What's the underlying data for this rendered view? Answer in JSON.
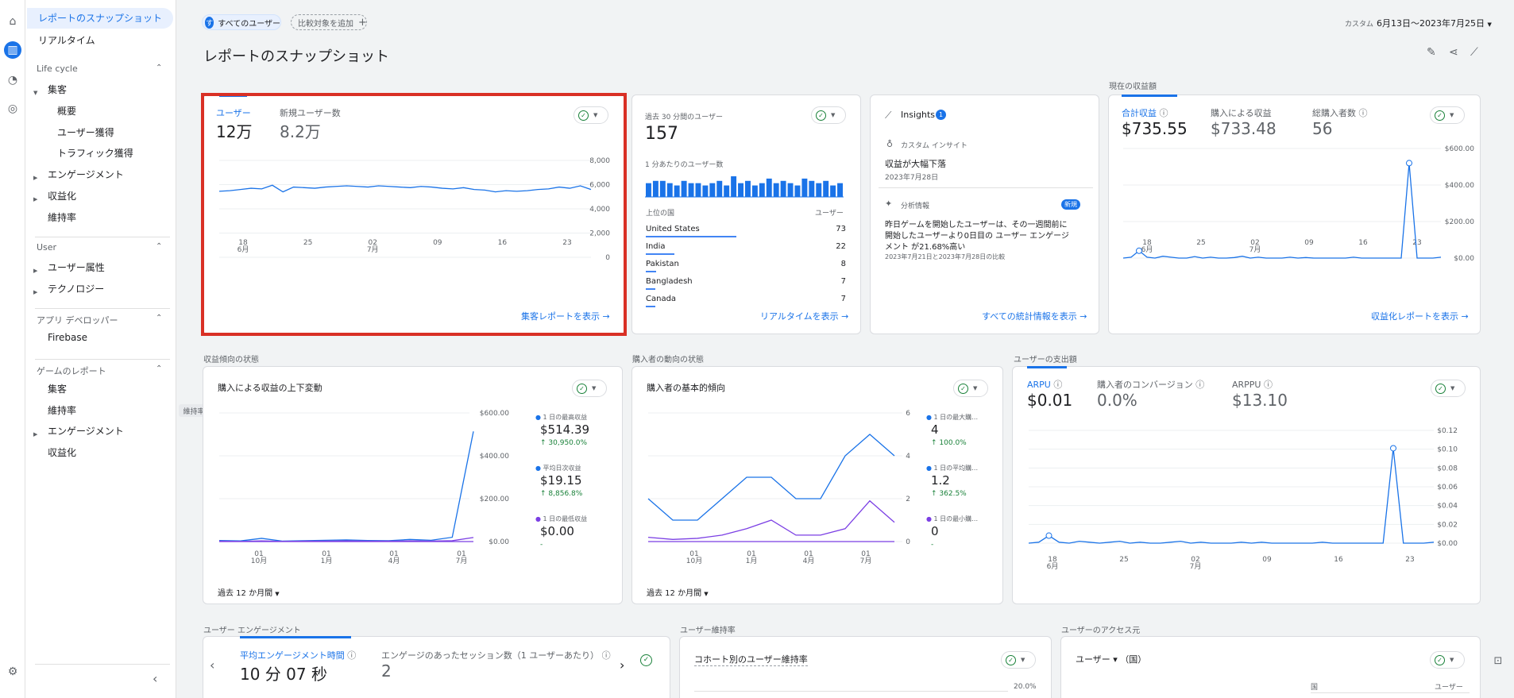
{
  "nav": {
    "items": [
      {
        "label": "レポートのスナップショット",
        "top": 22,
        "left": 48
      },
      {
        "label": "リアルタイム",
        "top": 50,
        "left": 48
      },
      {
        "label": "集客",
        "top": 112,
        "left": 60
      },
      {
        "label": "概要",
        "top": 139,
        "left": 72
      },
      {
        "label": "ユーザー獲得",
        "top": 166,
        "left": 72
      },
      {
        "label": "トラフィック獲得",
        "top": 192,
        "left": 72
      },
      {
        "label": "エンゲージメント",
        "top": 219,
        "left": 60
      },
      {
        "label": "収益化",
        "top": 246,
        "left": 60
      },
      {
        "label": "維持率",
        "top": 273,
        "left": 60
      },
      {
        "label": "ユーザー属性",
        "top": 336,
        "left": 60
      },
      {
        "label": "テクノロジー",
        "top": 363,
        "left": 60
      },
      {
        "label": "Firebase",
        "top": 426,
        "left": 60
      },
      {
        "label": "集客",
        "top": 489,
        "left": 60
      },
      {
        "label": "維持率",
        "top": 516,
        "left": 60
      },
      {
        "label": "エンゲージメント",
        "top": 542,
        "left": 60
      },
      {
        "label": "収益化",
        "top": 569,
        "left": 60
      }
    ],
    "sections": [
      "Life cycle",
      "User",
      "アプリ デベロッパー",
      "ゲームのレポート"
    ],
    "tooltip": "維持率"
  },
  "top": {
    "all_users_initial": "す",
    "all_users": "すべてのユーザー",
    "add_compare": "比較対象を追加",
    "date_prefix": "カスタム",
    "date_range": "6月13日～2023年7月25日",
    "title": "レポートのスナップショット"
  },
  "card_users": {
    "m1_label": "ユーザー",
    "m1_value": "12万",
    "m2_label": "新規ユーザー数",
    "m2_value": "8.2万",
    "yticks": [
      "8,000",
      "6,000",
      "4,000",
      "2,000",
      "0"
    ],
    "xticks": [
      [
        "18",
        "6月"
      ],
      [
        "25",
        ""
      ],
      [
        "02",
        "7月"
      ],
      [
        "09",
        ""
      ],
      [
        "16",
        ""
      ],
      [
        "23",
        ""
      ]
    ],
    "link": "集客レポートを表示"
  },
  "card_realtime": {
    "label": "過去 30 分間のユーザー",
    "value": "157",
    "sub": "1 分あたりのユーザー数",
    "col1": "上位の国",
    "col2": "ユーザー",
    "rows": [
      {
        "name": "United States",
        "value": "73",
        "pct": 0.95
      },
      {
        "name": "India",
        "value": "22",
        "pct": 0.3
      },
      {
        "name": "Pakistan",
        "value": "8",
        "pct": 0.11
      },
      {
        "name": "Bangladesh",
        "value": "7",
        "pct": 0.1
      },
      {
        "name": "Canada",
        "value": "7",
        "pct": 0.1
      }
    ],
    "bars": [
      6,
      7,
      7,
      6,
      5,
      7,
      6,
      6,
      5,
      6,
      7,
      5,
      9,
      6,
      7,
      5,
      6,
      8,
      6,
      7,
      6,
      5,
      8,
      7,
      6,
      7,
      5,
      6
    ],
    "link": "リアルタイムを表示"
  },
  "card_insights": {
    "title": "Insights",
    "count": "1",
    "type1": "カスタム インサイト",
    "head1": "収益が大幅下落",
    "date1": "2023年7月28日",
    "type2": "分析情報",
    "badge": "新規",
    "body1": "昨日ゲームを開始したユーザーは、その一週間前に",
    "body2": "開始したユーザーより0日目の ユーザー エンゲージ",
    "body3": "メント が21.68%高い",
    "date2": "2023年7月21日と2023年7月28日の比較",
    "link": "すべての統計情報を表示"
  },
  "card_revenue": {
    "section": "現在の収益額",
    "m1_label": "合計収益",
    "m1_value": "$735.55",
    "m2_label": "購入による収益",
    "m2_value": "$733.48",
    "m3_label": "総購入者数",
    "m3_value": "56",
    "yticks": [
      "$600.00",
      "$400.00",
      "$200.00",
      "$0.00"
    ],
    "xticks": [
      [
        "18",
        "6月"
      ],
      [
        "25",
        ""
      ],
      [
        "02",
        "7月"
      ],
      [
        "09",
        ""
      ],
      [
        "16",
        ""
      ],
      [
        "23",
        ""
      ]
    ],
    "link": "収益化レポートを表示"
  },
  "card_rev_trend": {
    "section": "収益傾向の状態",
    "title": "購入による収益の上下変動",
    "yticks": [
      "$600.00",
      "$400.00",
      "$200.00",
      "$0.00"
    ],
    "xticks": [
      [
        "01",
        "10月"
      ],
      [
        "01",
        "1月"
      ],
      [
        "01",
        "4月"
      ],
      [
        "01",
        "7月"
      ]
    ],
    "leg": [
      {
        "label": "1 日の最高収益",
        "value": "$514.39",
        "delta": "↑ 30,950.0%"
      },
      {
        "label": "平均日次収益",
        "value": "$19.15",
        "delta": "↑ 8,856.8%"
      },
      {
        "label": "1 日の最低収益",
        "value": "$0.00",
        "delta": "-"
      }
    ],
    "period": "過去 12 か月間"
  },
  "card_buyer_trend": {
    "section": "購入者の動向の状態",
    "title": "購入者の基本的傾向",
    "yticks": [
      "6",
      "4",
      "2",
      "0"
    ],
    "xticks": [
      [
        "01",
        "10月"
      ],
      [
        "01",
        "1月"
      ],
      [
        "01",
        "4月"
      ],
      [
        "01",
        "7月"
      ]
    ],
    "leg": [
      {
        "label": "1 日の最大購…",
        "value": "4",
        "delta": "↑ 100.0%"
      },
      {
        "label": "1 日の平均購…",
        "value": "1.2",
        "delta": "↑ 362.5%"
      },
      {
        "label": "1 日の最小購…",
        "value": "0",
        "delta": "-"
      }
    ],
    "period": "過去 12 か月間"
  },
  "card_spend": {
    "section": "ユーザーの支出額",
    "m1_label": "ARPU",
    "m1_value": "$0.01",
    "m2_label": "購入者のコンバージョン",
    "m2_value": "0.0%",
    "m3_label": "ARPPU",
    "m3_value": "$13.10",
    "yticks": [
      "$0.12",
      "$0.10",
      "$0.08",
      "$0.06",
      "$0.04",
      "$0.02",
      "$0.00"
    ],
    "xticks": [
      [
        "18",
        "6月"
      ],
      [
        "25",
        ""
      ],
      [
        "02",
        "7月"
      ],
      [
        "09",
        ""
      ],
      [
        "16",
        ""
      ],
      [
        "23",
        ""
      ]
    ]
  },
  "card_engage": {
    "section": "ユーザー エンゲージメント",
    "m1_label": "平均エンゲージメント時間",
    "m1_value": "10 分 07 秒",
    "m2_label": "エンゲージのあったセッション数（1 ユーザーあたり）",
    "m2_value": "2"
  },
  "card_retention": {
    "section": "ユーザー維持率",
    "title": "コホート別のユーザー維持率",
    "ytick": "20.0%"
  },
  "card_access": {
    "section": "ユーザーのアクセス元",
    "title": "ユーザー ▾ （国）",
    "col1": "国",
    "col2": "ユーザー"
  }
}
